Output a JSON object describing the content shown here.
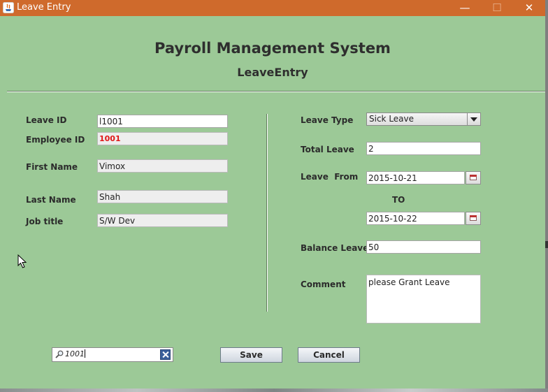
{
  "window": {
    "title": "Leave Entry",
    "minimize": "—",
    "maximize": "☐",
    "close": "✕"
  },
  "header": {
    "title": "Payroll Management System",
    "subtitle": "LeaveEntry"
  },
  "left": {
    "leave_id_label": "Leave ID",
    "leave_id_value": "l1001",
    "employee_id_label": "Employee ID",
    "employee_id_value": "1001",
    "first_name_label": "First Name",
    "first_name_value": "Vimox",
    "last_name_label": "Last Name",
    "last_name_value": "Shah",
    "job_title_label": "Job title",
    "job_title_value": "S/W Dev"
  },
  "right": {
    "leave_type_label": "Leave Type",
    "leave_type_value": "Sick Leave",
    "total_leave_label": "Total Leave",
    "total_leave_value": "2",
    "leave_from_label": "Leave  From",
    "leave_from_value": "2015-10-21",
    "to_label": "TO",
    "leave_to_value": "2015-10-22",
    "balance_leave_label": "Balance Leave",
    "balance_leave_value": "50",
    "comment_label": "Comment",
    "comment_value": "please Grant Leave"
  },
  "search": {
    "value": "1001"
  },
  "buttons": {
    "save": "Save",
    "cancel": "Cancel"
  },
  "icons": [
    "java-app-icon",
    "search-icon",
    "clear-icon",
    "calendar-icon",
    "chevron-down-icon"
  ],
  "colors": {
    "titlebar": "#cf6a2c",
    "background": "#9cc997",
    "employee_id_text": "#e01818"
  }
}
